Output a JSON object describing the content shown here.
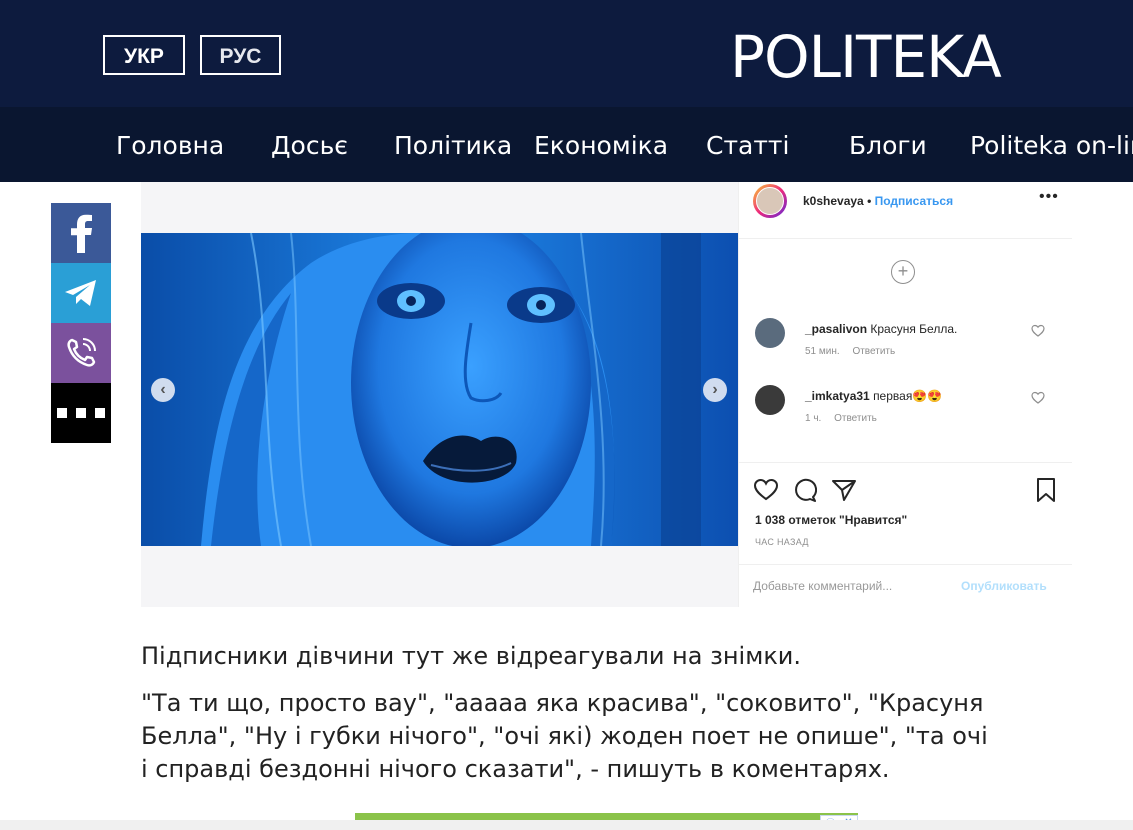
{
  "header": {
    "lang_ukr": "УКР",
    "lang_rus": "РУС",
    "logo": "POLITEKA",
    "bg_color": "#0d1b3e"
  },
  "nav": {
    "items": [
      "Головна",
      "Досьє",
      "Політика",
      "Економіка",
      "Статті",
      "Блоги",
      "Politeka on-line"
    ]
  },
  "share": {
    "items": [
      "facebook-icon",
      "telegram-icon",
      "viber-icon",
      "more-icon"
    ]
  },
  "instagram": {
    "username": "k0shevaya",
    "follow": "Подписаться",
    "more": "•••",
    "comments": [
      {
        "user": "_pasalivon",
        "text": "Красуня Белла.",
        "time": "51 мин.",
        "reply": "Ответить"
      },
      {
        "user": "_imkatya31",
        "text": "первая😍😍",
        "time": "1 ч.",
        "reply": "Ответить"
      }
    ],
    "likes": "1 038 отметок \"Нравится\"",
    "posted": "ЧАС НАЗАД",
    "comment_placeholder": "Добавьте комментарий...",
    "publish": "Опубликовать",
    "carousel_dots": 4,
    "carousel_active": 1
  },
  "article": {
    "p1": "Підписники дівчини тут же відреагували на знімки.",
    "p2": "\"Та ти що, просто вау\", \"ааааа яка красива\", \"соковито\", \"Красуня Белла\", \"Ну і губки нічого\", \"очі які) жоден поет не опише\", \"та очі і справді бездонні нічого сказати\", - пишуть в коментарях."
  },
  "ad": {
    "info": "ⓘ",
    "close": "✕"
  }
}
